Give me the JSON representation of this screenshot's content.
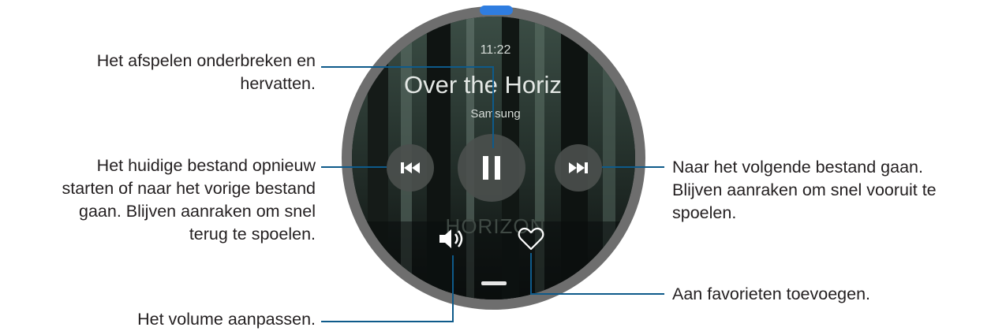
{
  "watch": {
    "time": "11:22",
    "song_title": "Over the Horiz",
    "artist": "Samsung",
    "album_art_text": "HORIZON",
    "icons": {
      "previous": "skip-previous-icon",
      "play_pause": "pause-icon",
      "next": "skip-next-icon",
      "volume": "volume-icon",
      "favorite": "heart-outline-icon"
    }
  },
  "callouts": {
    "pause_resume": [
      "Het afspelen onderbreken en",
      "hervatten."
    ],
    "previous": [
      "Het huidige bestand opnieuw",
      "starten of naar het vorige bestand",
      "gaan. Blijven aanraken om snel",
      "terug te spoelen."
    ],
    "next": [
      "Naar het volgende bestand gaan.",
      "Blijven aanraken om snel vooruit te",
      "spoelen."
    ],
    "favorite": [
      "Aan favorieten toevoegen."
    ],
    "volume": [
      "Het volume aanpassen."
    ]
  },
  "colors": {
    "callout_line": "#0e5a8a",
    "crown_indicator": "#2f7de0",
    "watch_bezel": "#6e6e6e"
  }
}
